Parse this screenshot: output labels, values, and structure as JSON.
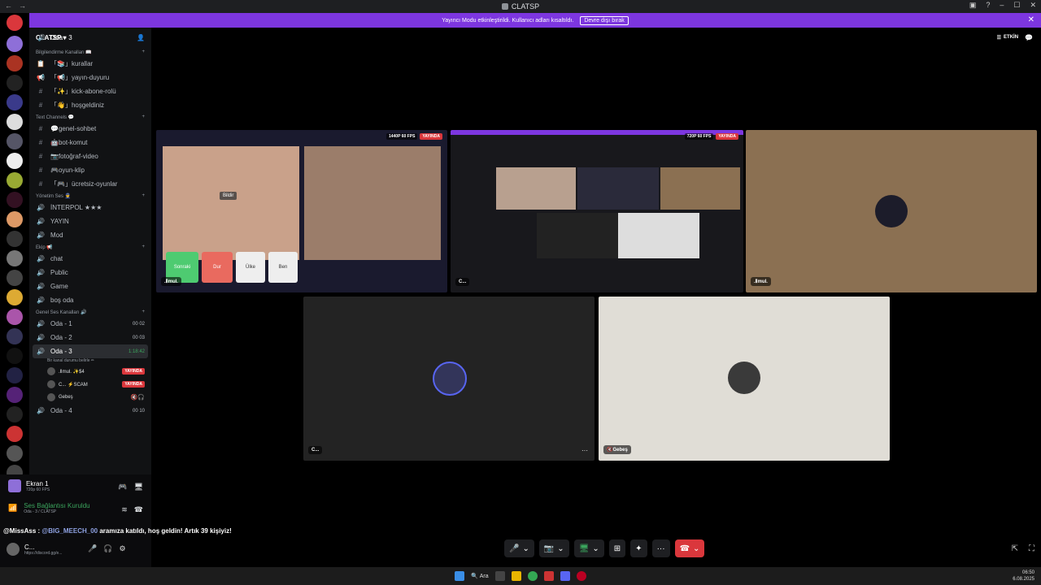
{
  "window": {
    "title": "CLATSP"
  },
  "banner": {
    "text": "Yayıncı Modu etkinleştirildi. Kullanıcı adları kısaltıldı.",
    "button": "Devre dışı bırak"
  },
  "server": {
    "name": "CLATSP"
  },
  "categories": [
    {
      "name": "Bilgilendirme Kanalları 📖",
      "channels": [
        {
          "icon": "rules",
          "label": "「📚」kurallar"
        },
        {
          "icon": "announce",
          "label": "「📢」yayın-duyuru"
        },
        {
          "icon": "hash",
          "label": "「✨」kick-abone-rolü"
        },
        {
          "icon": "hash",
          "label": "「👋」hoşgeldiniz"
        }
      ]
    },
    {
      "name": "Text Channels 💬",
      "channels": [
        {
          "icon": "hash",
          "label": "💬genel-sohbet"
        },
        {
          "icon": "hash",
          "label": "🤖bot-komut"
        },
        {
          "icon": "hash",
          "label": "📷fotoğraf-video"
        },
        {
          "icon": "hash",
          "label": "🎮oyun-klip"
        },
        {
          "icon": "hash",
          "label": "「🎮」ücretsiz-oyunlar"
        }
      ]
    },
    {
      "name": "Yönetim Ses 👮",
      "channels": [
        {
          "icon": "speaker",
          "label": "İNTERPOL ★★★"
        },
        {
          "icon": "speaker",
          "label": "YAYIN"
        },
        {
          "icon": "speaker",
          "label": "Mod"
        }
      ]
    },
    {
      "name": "Ekip 📢",
      "channels": [
        {
          "icon": "speaker",
          "label": "chat"
        },
        {
          "icon": "speaker",
          "label": "Public"
        },
        {
          "icon": "speaker",
          "label": "Game"
        },
        {
          "icon": "speaker",
          "label": "boş oda"
        }
      ]
    }
  ],
  "voice_category": {
    "name": "Genel Ses Kanalları 🔊"
  },
  "voice_channels": [
    {
      "label": "Oda - 1",
      "timer": "00 02"
    },
    {
      "label": "Oda - 2",
      "timer": "00 03"
    },
    {
      "label": "Oda - 3",
      "timer": "1:18:42",
      "status": "Bir kanal durumu belirle ✏"
    },
    {
      "label": "Oda - 4",
      "timer": "00 10"
    }
  ],
  "members": [
    {
      "name": ".Ⅱmul. ✨$4",
      "live": "YAYINDA"
    },
    {
      "name": "C... ⚡SCAM",
      "live": "YAYINDA"
    },
    {
      "name": "Gebeş",
      "icons": "🔇🎧"
    }
  ],
  "screen_share": {
    "title": "Ekran 1",
    "sub": "720p 60 FPS"
  },
  "voice_status": {
    "title": "Ses Bağlantısı Kuruldu",
    "sub": "Oda - 3 / CLATSP"
  },
  "user": {
    "name": "C...",
    "status": "https://discord.gg/e..."
  },
  "channel_header": {
    "title": "Oda - 3",
    "activity": "ETKİN"
  },
  "tiles": [
    {
      "label": ".Ⅱmul.",
      "quality": "1440P 60 FPS",
      "live": "YAYINDA",
      "buttons": [
        "Sonraki",
        "Dur",
        "Ülke",
        "Ben"
      ],
      "report": "Bildir"
    },
    {
      "label": "C...",
      "quality": "720P 60 FPS",
      "live": "YAYINDA"
    },
    {
      "label": ".Ⅱmul."
    },
    {
      "label": "C..."
    },
    {
      "label": "Gebeş"
    }
  ],
  "chat": {
    "user": "@MissAss :",
    "mention": "@BIG_MEECH_00",
    "text": "aramıza katıldı, hoş geldin! Artık 39 kişiyiz!"
  },
  "taskbar": {
    "search": "Ara",
    "time": "06:50",
    "date": "6.08.2025"
  },
  "colors": {
    "accent": "#5865f2",
    "live": "#da373c",
    "banner": "#7d36e0"
  }
}
